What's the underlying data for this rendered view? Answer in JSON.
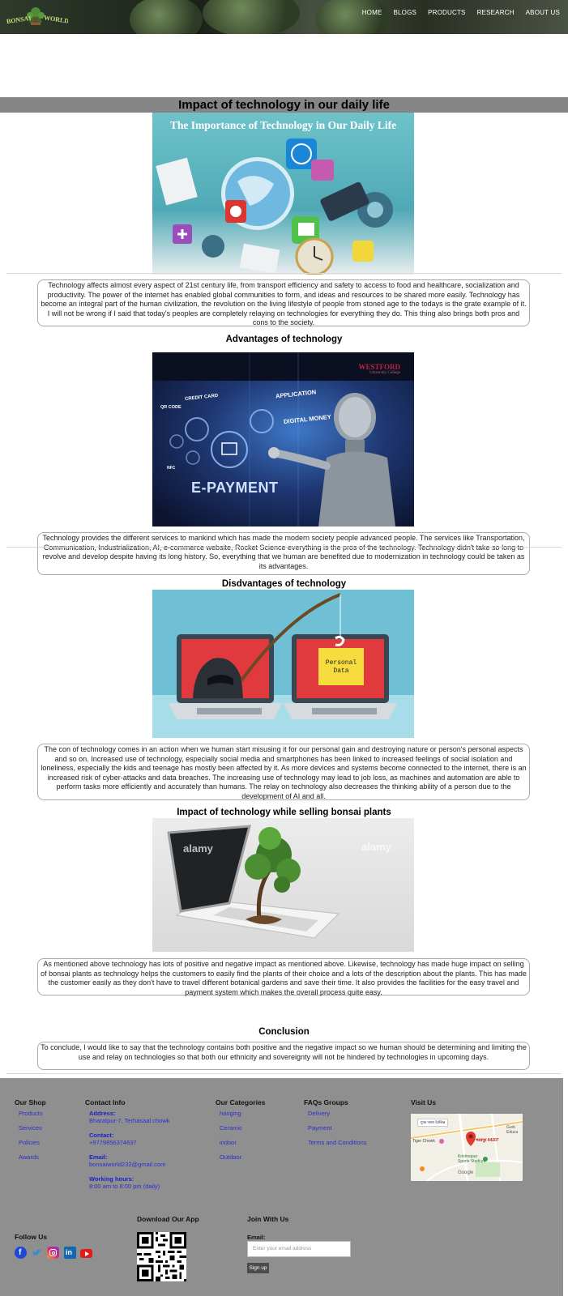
{
  "site": {
    "logo_text": "BONSAI WORLD"
  },
  "nav": {
    "items": [
      "HOME",
      "BLOGS",
      "PRODUCTS",
      "RESEARCH",
      "ABOUT US"
    ]
  },
  "page": {
    "title": "Impact of technology in our daily life",
    "hero_caption": "The Importance of Technology in Our Daily Life",
    "intro": "Technology affects almost every aspect of 21st century life, from transport efficiency and safety to access to food and healthcare, socialization and productivity. The power of the internet has enabled global communities to form, and ideas and resources to be shared more easily. Technology has become an integral part of the human civilization, the revolution on the living lifestyle of people from stoned age to the todays is the grate example of it. I will not be wrong if I said that today's peoples are completely relaying on technologies for everything they do. This thing also brings both pros and cons to the society.",
    "advantages_heading": "Advantages of technology",
    "advantages_image": {
      "labels": [
        "WESTFORD",
        "University College",
        "CREDIT CARD",
        "QR CODE",
        "APPLICATION",
        "DIGITAL MONEY",
        "NFC",
        "E-PAYMENT"
      ]
    },
    "advantages_text": "Technology provides the different services to mankind which has made the modern society people advanced people. The services like Transportation, Communication, Industrialization, AI, e-commerce website, Rocket Science everything is the pros of the technology. Technology didn't take so long to revolve and develop despite having its long history. So, everything that we human are benefited due to modernization in technology could be taken as its advantages.",
    "disadvantages_heading": "Disdvantages of technology",
    "disadvantages_image": {
      "note": "Personal Data"
    },
    "disadvantages_text": "The con of technology comes in an action when we human start misusing it for our personal gain and destroying nature or person's personal aspects and so on. Increased use of technology, especially social media and smartphones has been linked to increased feelings of social isolation and loneliness, especially the kids and teenage has mostly been affected by it. As more devices and systems become connected to the internet, there is an increased risk of cyber-attacks and data breaches. The increasing use of technology may lead to job loss, as machines and automation are able to perform tasks more efficiently and accurately than humans. The relay on technology also decreases the thinking ability of a person due to the development of AI and all.",
    "bonsai_heading": "Impact of technology while selling bonsai plants",
    "bonsai_image": {
      "watermark": "alamy"
    },
    "bonsai_text": "As mentioned above technology has lots of positive and negative impact as mentioned above. Likewise, technology has made huge impact on selling of bonsai plants as technology helps the customers to easily find the plants of their choice and a lots of the description about the plants. This has made the customer easily as they don't have to travel different botanical gardens and save their time. It also provides the facilities for the easy travel and payment system which makes the overall process quite easy.",
    "conclusion_heading": "Conclusion",
    "conclusion_text": "To conclude, I would like to say that the technology contains both positive and the negative impact so we human should be determining and limiting the use and relay on technologies so that both our ethnicity and sovereignty will not be hindered by technologies in upcoming days."
  },
  "footer": {
    "shop": {
      "title": "Our Shop",
      "items": [
        "Products",
        "Services",
        "Policies",
        "Awards"
      ]
    },
    "contact": {
      "title": "Contact Info",
      "address_label": "Address:",
      "address": "Bharatpur-7, Terhasaal chowk",
      "contact_label": "Contact:",
      "contact": "+9779856374637",
      "email_label": "Email:",
      "email": "bonsaiworld232@gmail.com",
      "hours_label": "Working hours:",
      "hours": "8:00 am to 8:00 pm (daily)"
    },
    "categories": {
      "title": "Our Categories",
      "items": [
        "hanging",
        "Ceramic",
        "indoor",
        "Outdoor"
      ]
    },
    "faqs": {
      "title": "FAQs Groups",
      "items": [
        "Delivery",
        "Payment",
        "Terms and Conditions"
      ]
    },
    "visit": {
      "title": "Visit Us",
      "map_labels": [
        "गुफा नसरा देउंकिन्न",
        "भरतपुर 44207",
        "Tiger Chowk",
        "Krishnapur Sports Stadium",
        "Google",
        "Gurk Educa"
      ]
    },
    "follow": {
      "title": "Follow Us"
    },
    "app": {
      "title": "Download Our App"
    },
    "join": {
      "title": "Join With Us",
      "email_label": "Email:",
      "email_placeholder": "Enter your email address",
      "signup": "Sign up"
    }
  },
  "colors": {
    "banner": "#858585",
    "footer": "#8f8f8f",
    "link": "#2a2fd0"
  }
}
